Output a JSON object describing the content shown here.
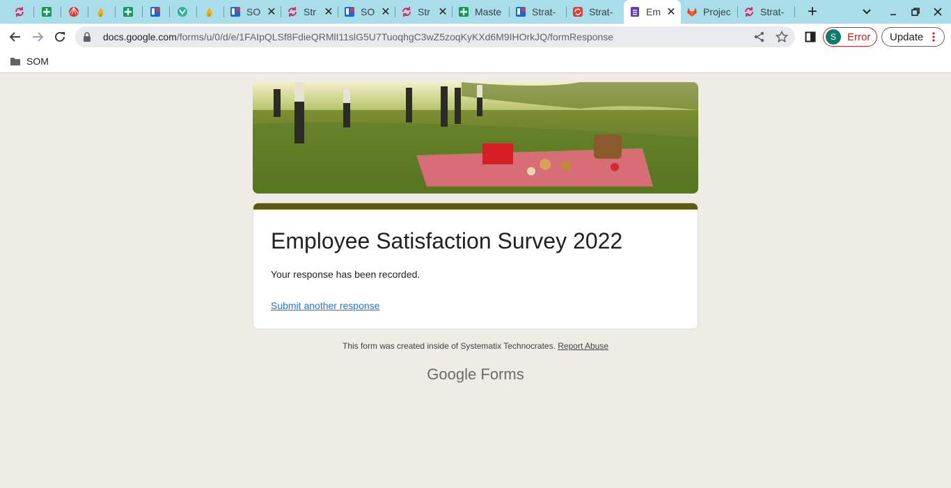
{
  "browser": {
    "tabs": [
      {
        "title": "",
        "icon": "strat-sync-icon",
        "color": "#e0245e"
      },
      {
        "title": "",
        "icon": "sheets-icon",
        "color": "#0f9d58"
      },
      {
        "title": "",
        "icon": "shell-icon",
        "color": "#dd3322"
      },
      {
        "title": "",
        "icon": "flame-icon",
        "color": "#f4b400"
      },
      {
        "title": "",
        "icon": "sheets-icon",
        "color": "#0f9d58"
      },
      {
        "title": "",
        "icon": "trello-icon",
        "color": "#1868db"
      },
      {
        "title": "",
        "icon": "teal-badge-icon",
        "color": "#2bb59a"
      },
      {
        "title": "",
        "icon": "flame-icon",
        "color": "#f4b400"
      },
      {
        "title": "SO",
        "icon": "trello-icon",
        "color": "#1868db"
      },
      {
        "title": "Str",
        "icon": "strat-sync-icon",
        "color": "#e0245e"
      },
      {
        "title": "SO",
        "icon": "trello-icon",
        "color": "#1868db"
      },
      {
        "title": "Str",
        "icon": "strat-sync-icon",
        "color": "#e0245e"
      },
      {
        "title": "Maste",
        "icon": "sheets-icon",
        "color": "#0f9d58"
      },
      {
        "title": "Strat-",
        "icon": "trello-icon",
        "color": "#1868db"
      },
      {
        "title": "Strat-",
        "icon": "strat-red-icon",
        "color": "#e53935"
      },
      {
        "title": "Em",
        "icon": "forms-icon",
        "color": "#673ab7"
      },
      {
        "title": "Projec",
        "icon": "gitlab-icon",
        "color": "#e24329"
      },
      {
        "title": "Strat-",
        "icon": "strat-sync-icon",
        "color": "#e0245e"
      }
    ],
    "close_glyph": "✕",
    "new_tab_glyph": "+",
    "url_host": "docs.google.com",
    "url_path": "/forms/u/0/d/e/1FAIpQLSf8FdieQRMlI11slG5U7TuoqhgC3wZ5zoqKyKXd6M9IHOrkJQ/formResponse",
    "profile_initial": "S",
    "profile_color": "#0f7b6c",
    "error_label": "Error",
    "update_label": "Update",
    "bookmark_folder": "SOM"
  },
  "form": {
    "title": "Employee Satisfaction Survey 2022",
    "message": "Your response has been recorded.",
    "another_link": "Submit another response",
    "header_color": "#5b5b14",
    "footer_text": "This form was created inside of Systematix Technocrates.",
    "report_link": "Report Abuse",
    "brand_google": "Google",
    "brand_forms": "Forms"
  }
}
